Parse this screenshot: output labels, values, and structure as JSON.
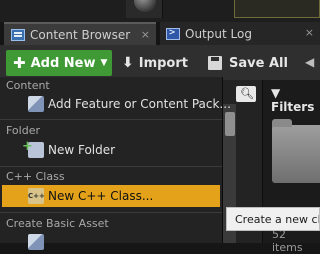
{
  "tabs": [
    {
      "label": "Content Browser",
      "close": "×"
    },
    {
      "label": "Output Log",
      "close": "×"
    }
  ],
  "toolbar": {
    "add_new_label": "Add New",
    "import_label": "Import",
    "save_all_label": "Save All"
  },
  "filters_label": "Filters",
  "items_count": "52 items",
  "menu": {
    "sections": [
      {
        "header": "Content",
        "items": [
          {
            "label": "Add Feature or Content Pack...",
            "icon": "cube-icon"
          }
        ]
      },
      {
        "header": "Folder",
        "items": [
          {
            "label": "New Folder",
            "icon": "new-folder-icon"
          }
        ]
      },
      {
        "header": "C++ Class",
        "items": [
          {
            "label": "New C++ Class...",
            "icon": "cpp-class-icon"
          }
        ]
      },
      {
        "header": "Create Basic Asset",
        "items": []
      }
    ],
    "highlight_color": "#e3a21a"
  },
  "tooltip": "Create a new class",
  "colors": {
    "add_new_button": "#3f9a36",
    "accent": "#e3a21a"
  }
}
